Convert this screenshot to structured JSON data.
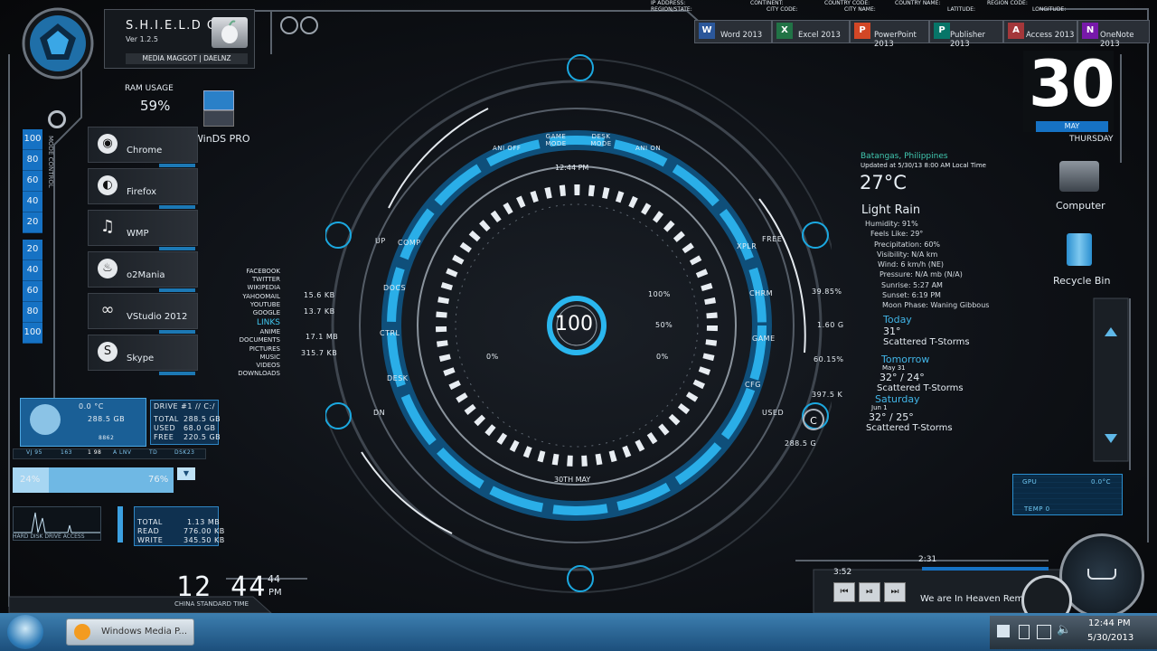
{
  "os": {
    "name": "S.H.I.E.L.D OS",
    "version": "Ver 1.2.5",
    "credit": "MEDIA MAGGOT | DAELNZ"
  },
  "ram": {
    "label": "RAM USAGE",
    "value": "59%"
  },
  "desktop_icons": {
    "winds": "WinDS PRO",
    "computer": "Computer",
    "recycle": "Recycle Bin"
  },
  "sidebar": {
    "items": [
      {
        "label": "Chrome",
        "icon": "chrome-icon"
      },
      {
        "label": "Firefox",
        "icon": "firefox-icon"
      },
      {
        "label": "WMP",
        "icon": "music-note-icon"
      },
      {
        "label": "o2Mania",
        "icon": "flame-icon"
      },
      {
        "label": "VStudio 2012",
        "icon": "infinity-icon"
      },
      {
        "label": "Skype",
        "icon": "skype-icon"
      }
    ],
    "scale_top": [
      "100",
      "80",
      "60",
      "40",
      "20"
    ],
    "scale_bottom": [
      "20",
      "40",
      "60",
      "80",
      "100"
    ],
    "rotated_label": "MODE CONTROL"
  },
  "office": [
    {
      "label": "Word 2013",
      "letter": "W",
      "color": "#2b579a"
    },
    {
      "label": "Excel 2013",
      "letter": "X",
      "color": "#217346"
    },
    {
      "label": "PowerPoint 2013",
      "letter": "P",
      "color": "#d24726"
    },
    {
      "label": "Publisher 2013",
      "letter": "P",
      "color": "#077568"
    },
    {
      "label": "Access 2013",
      "letter": "A",
      "color": "#a4373a"
    },
    {
      "label": "OneNote 2013",
      "letter": "N",
      "color": "#7719aa"
    }
  ],
  "header_labels": {
    "ip": "IP ADDRESS:",
    "region_state": "REGION/STATE:",
    "continent": "CONTINENT:",
    "city_code": "CITY CODE:",
    "country_code": "COUNTRY CODE:",
    "city_name": "CITY NAME:",
    "country_name": "COUNTRY NAME:",
    "latitude": "LATITUDE:",
    "region_code": "REGION CODE:",
    "longitude": "LONGITUDE:"
  },
  "date": {
    "day": "30",
    "month": "MAY",
    "weekday": "THURSDAY"
  },
  "weather": {
    "location": "Batangas, Philippines",
    "updated": "Updated at 5/30/13 8:00 AM Local Time",
    "temp": "27°C",
    "condition": "Light Rain",
    "details": [
      "Humidity: 91%",
      "Feels Like: 29°",
      "Precipitation: 60%",
      "Visibility: N/A km",
      "Wind: 6 km/h (NE)",
      "Pressure: N/A mb (N/A)",
      "Sunrise: 5:27 AM",
      "Sunset: 6:19 PM",
      "Moon Phase: Waning Gibbous"
    ],
    "today_label": "Today",
    "today_temp": "31°",
    "today_cond": "Scattered T-Storms",
    "tomorrow_label": "Tomorrow",
    "tomorrow_date": "May 31",
    "tomorrow_temp": "32° / 24°",
    "tomorrow_cond": "Scattered T-Storms",
    "saturday_label": "Saturday",
    "saturday_date": "Jun 1",
    "saturday_temp": "32° / 25°",
    "saturday_cond": "Scattered T-Storms"
  },
  "links": {
    "items": [
      "FACEBOOK",
      "TWITTER",
      "WIKIPEDIA",
      "YAHOOMAIL",
      "YOUTUBE",
      "GOOGLE"
    ],
    "header": "LINKS",
    "folders": [
      "ANIME",
      "DOCUMENTS",
      "PICTURES",
      "MUSIC",
      "VIDEOS",
      "DOWNLOADS"
    ]
  },
  "dial": {
    "center": "100",
    "time": "12:44 PM",
    "date": "30TH MAY",
    "top_modes": [
      "ANI OFF",
      "GAME MODE",
      "DESK MODE",
      "ANI ON"
    ],
    "left_ring": [
      "UP",
      "COMP",
      "DOCS",
      "CTRL",
      "DESK",
      "DN"
    ],
    "right_ring": [
      "FREE",
      "XPLR",
      "CHRM",
      "GAME",
      "CFG",
      "USED"
    ],
    "left_stats": [
      "15.6 KB",
      "13.7 KB",
      "17.1 MB",
      "315.7 KB"
    ],
    "right_stats": [
      "39.85%",
      "1.60 G",
      "60.15%",
      "397.5 K",
      "288.5 G"
    ],
    "inner_pcts": [
      "100%",
      "50%",
      "0%",
      "0%"
    ],
    "c_label": "C"
  },
  "drive": {
    "temp": "0.0 °C",
    "size": "288.5 GB",
    "tag": "8862",
    "title": "DRIVE #1 // C:/",
    "rows": [
      [
        "TOTAL",
        "288.5 GB"
      ],
      [
        "USED",
        "68.0 GB"
      ],
      [
        "FREE",
        "220.5 GB"
      ]
    ],
    "usage_left": "24%",
    "usage_right": "76%",
    "scale_row": [
      "VJ 95",
      "163",
      "1 98",
      "A LNV",
      "TD",
      "DSK23"
    ]
  },
  "hdd_access": {
    "label": "HARD DISK DRIVE ACCESS",
    "rows": [
      [
        "TOTAL",
        "1.13 MB"
      ],
      [
        "READ",
        "776.00 KB"
      ],
      [
        "WRITE",
        "345.50 KB"
      ]
    ]
  },
  "digital_clock": {
    "time": "12 44",
    "seconds": "44",
    "ampm": "PM",
    "zone": "CHINA STANDARD TIME"
  },
  "gpu": {
    "label": "GPU",
    "value": "0.0°C",
    "temp": "TEMP 0"
  },
  "media": {
    "elapsed": "3:52",
    "position": "2:31",
    "title": "We are In Heaven Remix"
  },
  "taskbar": {
    "window": "Windows Media P...",
    "time": "12:44 PM",
    "date": "5/30/2013"
  }
}
